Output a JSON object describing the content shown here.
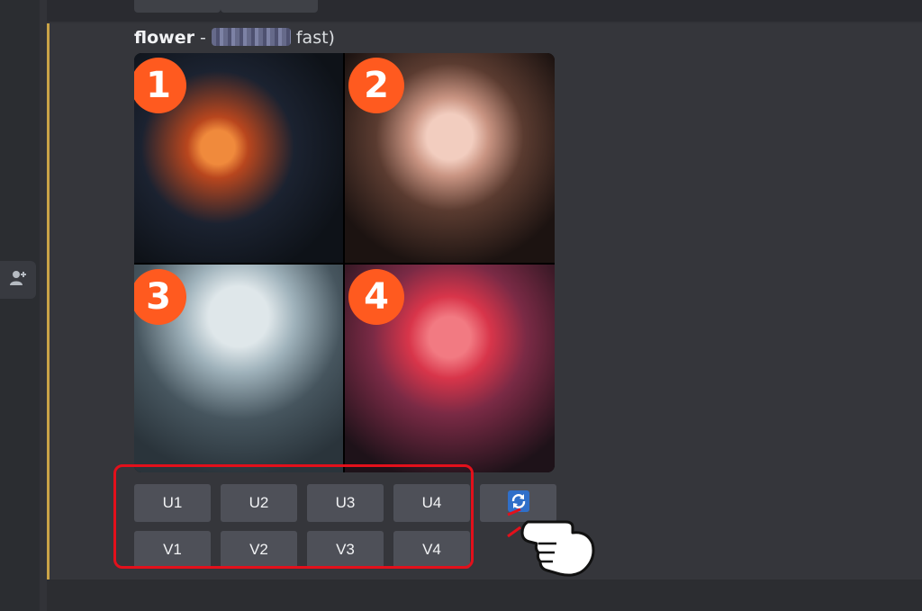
{
  "message": {
    "prompt_word": "flower",
    "separator": "-",
    "suffix": "fast)"
  },
  "grid": {
    "tiles": [
      {
        "badge": "1"
      },
      {
        "badge": "2"
      },
      {
        "badge": "3"
      },
      {
        "badge": "4"
      }
    ]
  },
  "buttons": {
    "upscale": [
      "U1",
      "U2",
      "U3",
      "U4"
    ],
    "variation": [
      "V1",
      "V2",
      "V3",
      "V4"
    ],
    "reroll_icon": "refresh-icon"
  },
  "colors": {
    "highlight": "#e3101b",
    "badge": "#ff5a1f",
    "accent_bar": "#c9a347",
    "button_bg": "#4e5058"
  },
  "icons": {
    "rail": "add-member-icon",
    "pointer": "pointing-hand-icon"
  }
}
